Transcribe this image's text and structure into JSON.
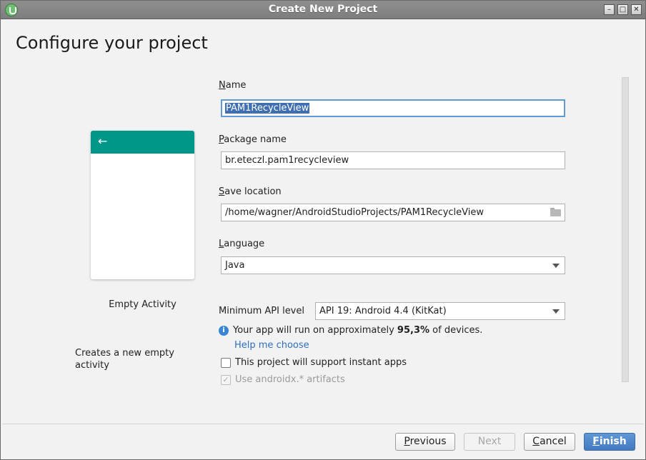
{
  "window": {
    "title": "Create New Project"
  },
  "page": {
    "title": "Configure your project"
  },
  "template": {
    "name": "Empty Activity",
    "description": "Creates a new empty activity",
    "appbar_color": "#009688"
  },
  "form": {
    "name": {
      "label_mnemonic": "N",
      "label_rest": "ame",
      "value": "PAM1RecycleView"
    },
    "package": {
      "label_mnemonic": "P",
      "label_rest": "ackage name",
      "value": "br.eteczl.pam1recycleview"
    },
    "save_location": {
      "label_mnemonic": "S",
      "label_rest": "ave location",
      "value": "/home/wagner/AndroidStudioProjects/PAM1RecycleView"
    },
    "language": {
      "label_mnemonic": "L",
      "label_rest": "anguage",
      "value": "Java"
    },
    "min_api": {
      "label": "Minimum API level",
      "value": "API 19: Android 4.4 (KitKat)"
    },
    "info": {
      "prefix": "Your app will run on approximately ",
      "percent": "95,3%",
      "suffix": " of devices."
    },
    "help_link": "Help me choose",
    "instant_apps": {
      "label": "This project will support instant apps",
      "checked": false
    },
    "androidx": {
      "label": "Use androidx.* artifacts",
      "checked": true,
      "enabled": false
    }
  },
  "buttons": {
    "previous": {
      "mnemonic": "P",
      "rest": "revious"
    },
    "next": {
      "mnemonic": "",
      "rest": "Next"
    },
    "cancel": {
      "mnemonic": "C",
      "rest": "ancel"
    },
    "finish": {
      "mnemonic": "F",
      "rest": "inish"
    }
  },
  "colors": {
    "accent": "#4479c0",
    "link": "#2f6fbf"
  }
}
